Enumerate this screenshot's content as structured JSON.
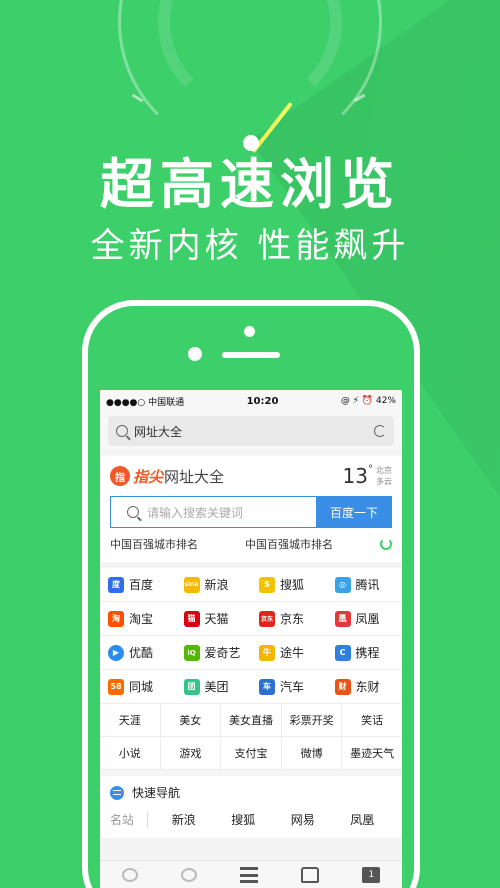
{
  "headline": "超高速浏览",
  "subline": "全新内核 性能飙升",
  "status": {
    "carrier": "●●●●○ 中国联通",
    "time": "10:20",
    "battery": "@ ⚡ ⏰ 42%"
  },
  "urlbar": {
    "text": "网址大全"
  },
  "brand": {
    "logo": "指",
    "name_part1": "指尖",
    "name_part2": "网址大全"
  },
  "weather": {
    "temp": "13",
    "unit": "°",
    "city": "北京",
    "condition": "多云"
  },
  "search": {
    "placeholder": "请输入搜索关键词",
    "button": "百度一下"
  },
  "hot": {
    "left": "中国百强城市排名",
    "right": "中国百强城市排名"
  },
  "sites": [
    [
      {
        "name": "百度",
        "icon": "度",
        "color": "#2e6ee6"
      },
      {
        "name": "新浪",
        "icon": "sina",
        "color": "#f5b800"
      },
      {
        "name": "搜狐",
        "icon": "S",
        "color": "#f2c300"
      },
      {
        "name": "腾讯",
        "icon": "◎",
        "color": "#3ba1e6"
      }
    ],
    [
      {
        "name": "淘宝",
        "icon": "淘",
        "color": "#ff5000"
      },
      {
        "name": "天猫",
        "icon": "猫",
        "color": "#d60012"
      },
      {
        "name": "京东",
        "icon": "京东",
        "color": "#e1251b"
      },
      {
        "name": "凤凰",
        "icon": "凰",
        "color": "#e4393c"
      }
    ],
    [
      {
        "name": "优酷",
        "icon": "▶",
        "color": "#2a8cf0"
      },
      {
        "name": "爱奇艺",
        "icon": "iQ",
        "color": "#52b800"
      },
      {
        "name": "途牛",
        "icon": "牛",
        "color": "#f0b800"
      },
      {
        "name": "携程",
        "icon": "C",
        "color": "#2e7fe0"
      }
    ],
    [
      {
        "name": "同城",
        "icon": "58",
        "color": "#ff6a00"
      },
      {
        "name": "美团",
        "icon": "团",
        "color": "#33c58a"
      },
      {
        "name": "汽车",
        "icon": "车",
        "color": "#2c6fd4"
      },
      {
        "name": "东财",
        "icon": "财",
        "color": "#e85418"
      }
    ]
  ],
  "text_links": [
    [
      "天涯",
      "美女",
      "美女直播",
      "彩票开奖",
      "笑话"
    ],
    [
      "小说",
      "游戏",
      "支付宝",
      "微博",
      "墨迹天气"
    ]
  ],
  "quick": {
    "title": "快速导航",
    "label": "名站",
    "links": [
      "新浪",
      "搜狐",
      "网易",
      "凤凰"
    ]
  },
  "toolbar": {
    "tabs_count": "1"
  }
}
